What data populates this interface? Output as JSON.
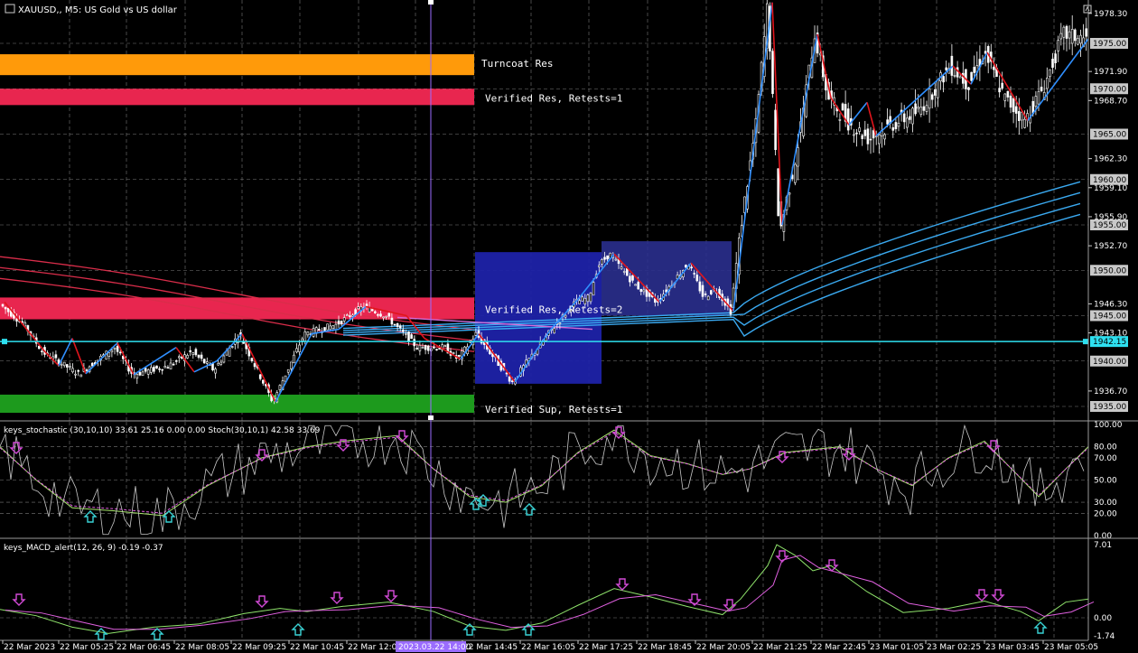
{
  "window": {
    "title": "XAUUSD,, M5:  US Gold vs US dollar"
  },
  "colors": {
    "background": "#000000",
    "grid": "#7a7a7a",
    "bull_candle": "#ffffff",
    "bear_candle": "#ffffff",
    "zigzag_up": "#2f8fff",
    "zigzag_down": "#e0151c",
    "ma_blue": "#3aa9f0",
    "ma_red": "#d92d4a",
    "current_line": "#2ee0f0",
    "stoch_main": "#c8c8c8",
    "stoch_signal": "#e060e0",
    "stoch_fast": "#a6e36b",
    "macd_main": "#8fe36b",
    "macd_signal": "#e060e0",
    "arrow_down": "#d24ad6",
    "arrow_up": "#39d3d6"
  },
  "price_axis": {
    "labels": [
      "1978.30",
      "1971.90",
      "1968.70",
      "1962.30",
      "1959.10",
      "1955.90",
      "1952.70",
      "1946.30",
      "1943.10",
      "1936.70"
    ],
    "tags": [
      {
        "text": "1975.00",
        "price": 1975.0
      },
      {
        "text": "1970.00",
        "price": 1970.0
      },
      {
        "text": "1965.00",
        "price": 1965.0
      },
      {
        "text": "1960.00",
        "price": 1960.0
      },
      {
        "text": "1955.00",
        "price": 1955.0
      },
      {
        "text": "1950.00",
        "price": 1950.0
      },
      {
        "text": "1945.00",
        "price": 1945.0
      },
      {
        "text": "1940.00",
        "price": 1940.0
      },
      {
        "text": "1935.00",
        "price": 1935.0
      }
    ],
    "current": {
      "text": "1942.15",
      "price": 1942.15
    }
  },
  "zones": [
    {
      "label": "Turncoat Res",
      "color": "#ff9a0a",
      "top": 1973.8,
      "bottom": 1971.5
    },
    {
      "label": "Verified Res, Retests=1",
      "color": "#e8264f",
      "top": 1970.0,
      "bottom": 1968.2
    },
    {
      "label": "Verified Res, Retests=2",
      "color": "#e8264f",
      "top": 1947.0,
      "bottom": 1944.6
    },
    {
      "label": "Verified Sup, Retests=1",
      "color": "#1d9a1d",
      "top": 1936.3,
      "bottom": 1934.3
    }
  ],
  "boxes": [
    {
      "name": "consolidation-box-1",
      "color": "#1d22a8",
      "top": 1952.0,
      "bottom": 1937.5
    },
    {
      "name": "consolidation-box-2",
      "color": "#2a2f8e",
      "top": 1953.2,
      "bottom": 1945.0
    }
  ],
  "time_axis": {
    "labels": [
      "22 Mar 2023",
      "22 Mar 05:25",
      "22 Mar 06:45",
      "22 Mar 08:05",
      "22 Mar 09:25",
      "22 Mar 10:45",
      "22 Mar 12:05",
      "22 Mar 14:45",
      "22 Mar 16:05",
      "22 Mar 17:25",
      "22 Mar 18:45",
      "22 Mar 20:05",
      "22 Mar 21:25",
      "22 Mar 22:45",
      "23 Mar 01:05",
      "23 Mar 02:25",
      "23 Mar 03:45",
      "23 Mar 05:05"
    ],
    "crosshair_label": "2023.03.22 14:00"
  },
  "stoch": {
    "label": "keys_stochastic (30,10,10) 33.61 25.16 0.00 0.00 Stoch(30,10,1) 42.58 33.69",
    "levels": [
      "100.00",
      "80.00",
      "70.00",
      "50.00",
      "30.00",
      "20.00",
      "0.00"
    ]
  },
  "macd": {
    "label": "keys_MACD_alert(12, 26, 9) -0.19 -0.37",
    "levels": [
      "7.01",
      "0.00",
      "-1.74"
    ]
  }
}
